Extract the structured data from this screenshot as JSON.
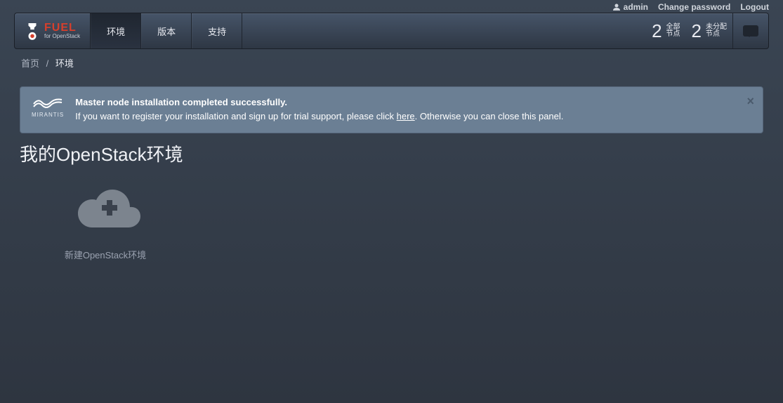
{
  "topbar": {
    "user": "admin",
    "change_password": "Change password",
    "logout": "Logout"
  },
  "nav": {
    "logo_main": "FUEL",
    "logo_sub": "for OpenStack",
    "items": [
      {
        "label": "环境",
        "active": true
      },
      {
        "label": "版本",
        "active": false
      },
      {
        "label": "支持",
        "active": false
      }
    ],
    "stats": [
      {
        "num": "2",
        "label": "全部\n节点"
      },
      {
        "num": "2",
        "label": "未分配\n节点"
      }
    ]
  },
  "breadcrumb": {
    "home": "首页",
    "current": "环境"
  },
  "alert": {
    "brand": "MIRANTIS",
    "line1": "Master node installation completed successfully.",
    "line2_a": "If you want to register your installation and sign up for trial support, please click ",
    "line2_link": "here",
    "line2_b": ". Otherwise you can close this panel."
  },
  "page": {
    "title": "我的OpenStack环境"
  },
  "tile": {
    "label": "新建OpenStack环境"
  }
}
